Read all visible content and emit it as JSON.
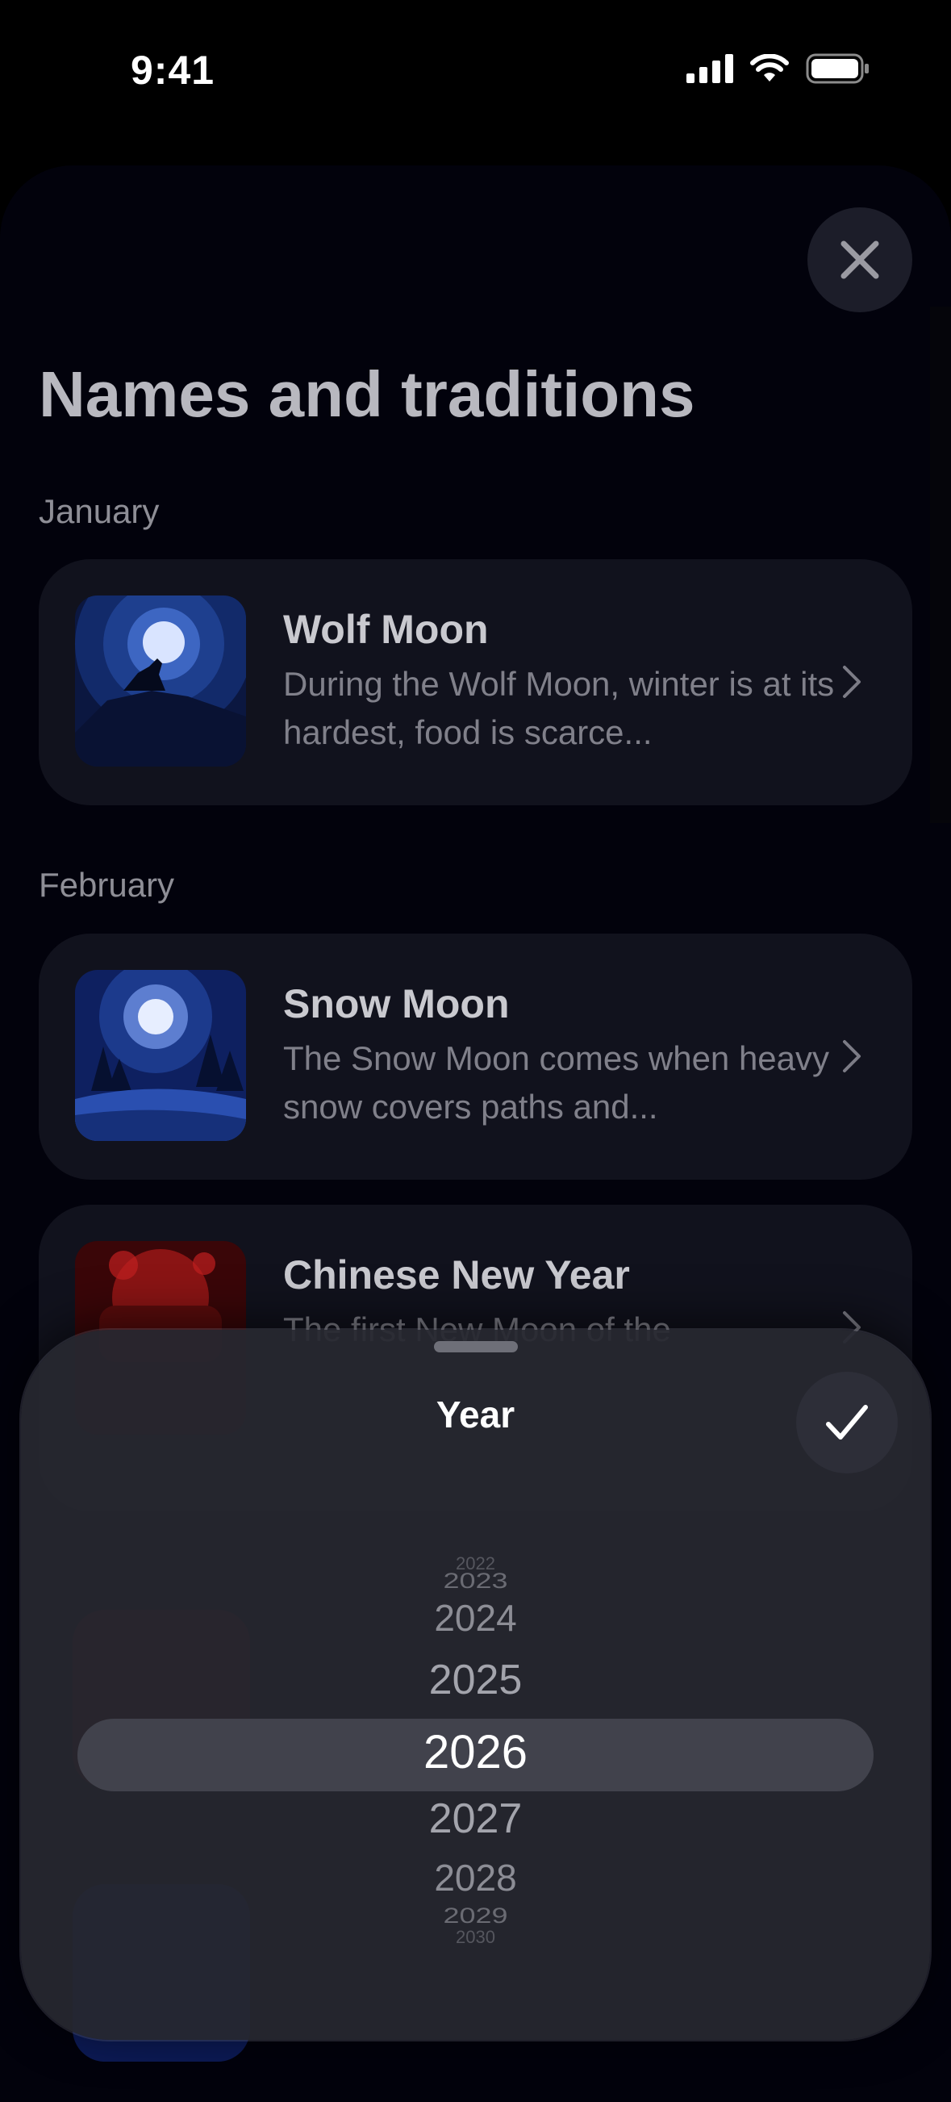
{
  "status_bar": {
    "time": "9:41"
  },
  "header": {
    "title": "Names and traditions"
  },
  "sections": [
    {
      "label": "January"
    },
    {
      "label": "February"
    }
  ],
  "cards": [
    {
      "title": "Wolf Moon",
      "description": "During the Wolf Moon, winter is at its hardest, food is scarce..."
    },
    {
      "title": "Snow Moon",
      "description": "The Snow Moon comes when heavy snow covers paths and..."
    },
    {
      "title": "Chinese New Year",
      "description": "The first New Moon of the"
    }
  ],
  "picker": {
    "title": "Year",
    "years": [
      "2022",
      "2023",
      "2024",
      "2025",
      "2026",
      "2027",
      "2028",
      "2029",
      "2030"
    ],
    "selected": "2026"
  },
  "icons": [
    "close-icon",
    "checkmark-icon",
    "chevron-right-icon",
    "signal-icon",
    "wifi-icon",
    "battery-icon"
  ]
}
